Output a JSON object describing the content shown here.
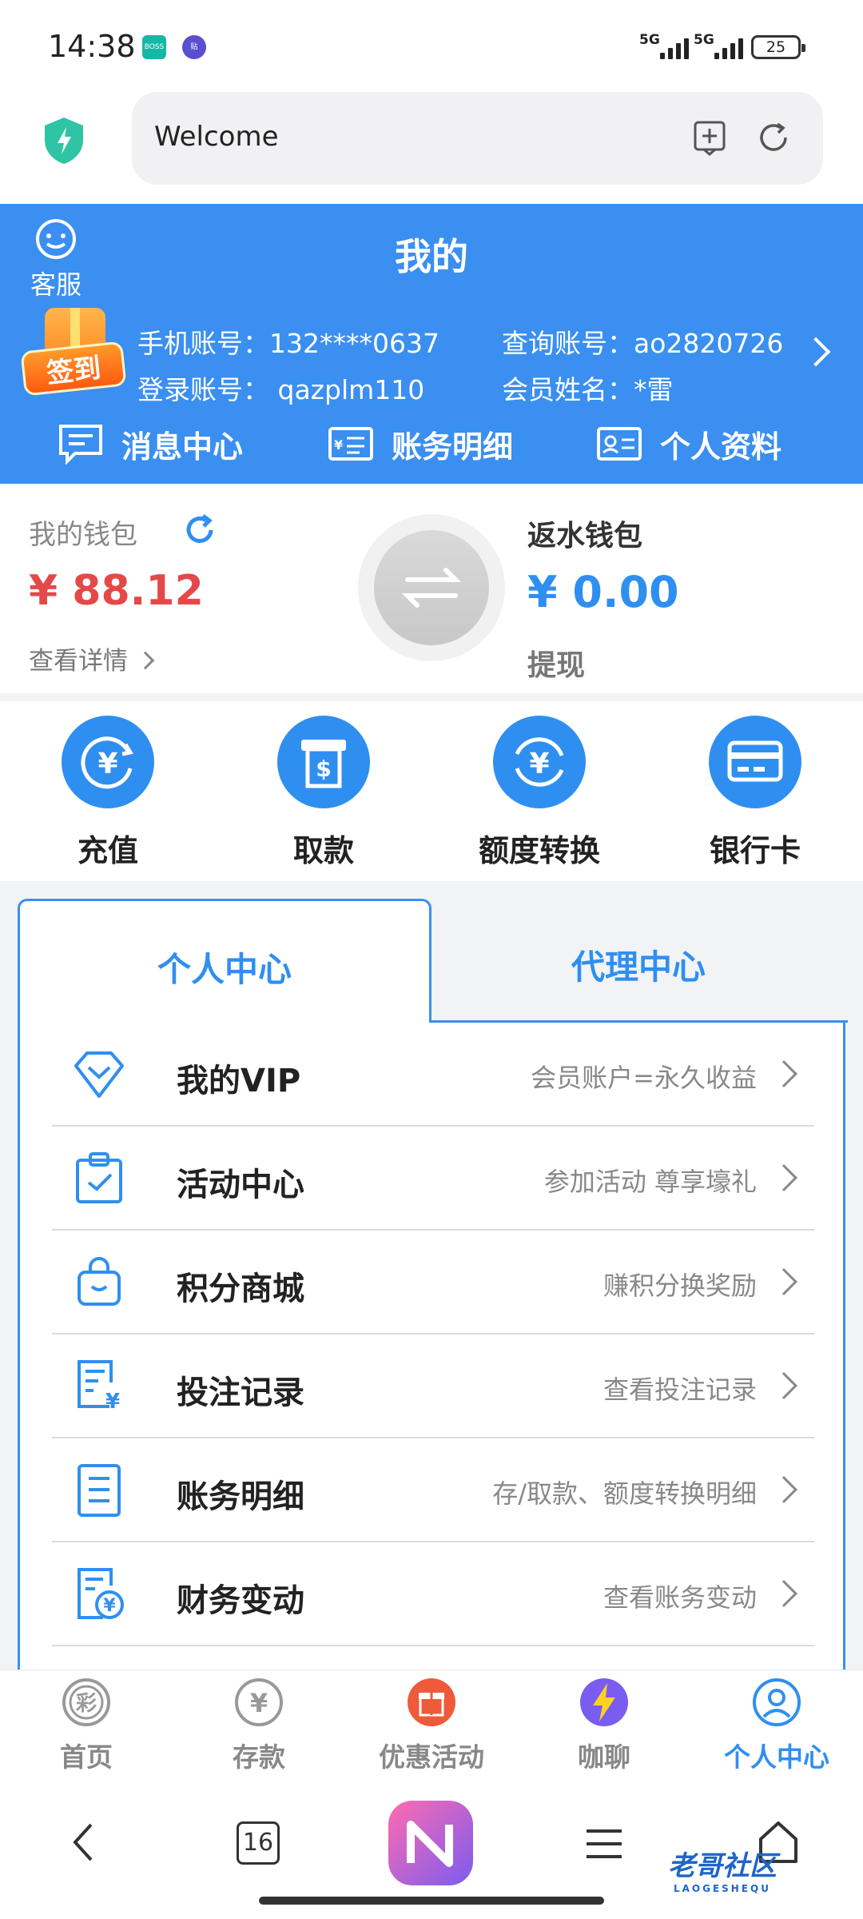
{
  "status_bar": {
    "time": "14:38",
    "app1": "BOSS直聘",
    "app2": "贴",
    "signal1": "5G",
    "signal2": "5G",
    "battery": "25"
  },
  "browser": {
    "url": "Welcome"
  },
  "header": {
    "service_label": "客服",
    "title": "我的",
    "signin_label": "签到",
    "phone_label": "手机账号：",
    "phone_value": "132****0637",
    "query_label": "查询账号：",
    "query_value": "ao2820726",
    "login_label": "登录账号：",
    "login_value": "qazplm110",
    "member_label": "会员姓名：",
    "member_value": "*雷",
    "quick_links": [
      "消息中心",
      "账务明细",
      "个人资料"
    ]
  },
  "wallet": {
    "label": "我的钱包",
    "amount": "¥ 88.12",
    "detail": "查看详情",
    "rebate_label": "返水钱包",
    "rebate_amount": "¥ 0.00",
    "withdraw": "提现"
  },
  "actions": [
    "充值",
    "取款",
    "额度转换",
    "银行卡"
  ],
  "tabs": {
    "personal": "个人中心",
    "agent": "代理中心"
  },
  "menu": [
    {
      "name": "我的VIP",
      "desc": "会员账户=永久收益"
    },
    {
      "name": "活动中心",
      "desc": "参加活动 尊享壕礼"
    },
    {
      "name": "积分商城",
      "desc": "赚积分换奖励"
    },
    {
      "name": "投注记录",
      "desc": "查看投注记录"
    },
    {
      "name": "账务明细",
      "desc": "存/取款、额度转换明细"
    },
    {
      "name": "财务变动",
      "desc": "查看账务变动"
    }
  ],
  "tabbar": [
    "首页",
    "存款",
    "优惠活动",
    "咖聊",
    "个人中心"
  ],
  "nav": {
    "tabs_count": "16",
    "brand": "老哥社区",
    "brand_sub": "LAOGESHEQU"
  },
  "colors": {
    "primary": "#3a8ff0",
    "accent_red": "#e54848",
    "gray": "#888888"
  }
}
